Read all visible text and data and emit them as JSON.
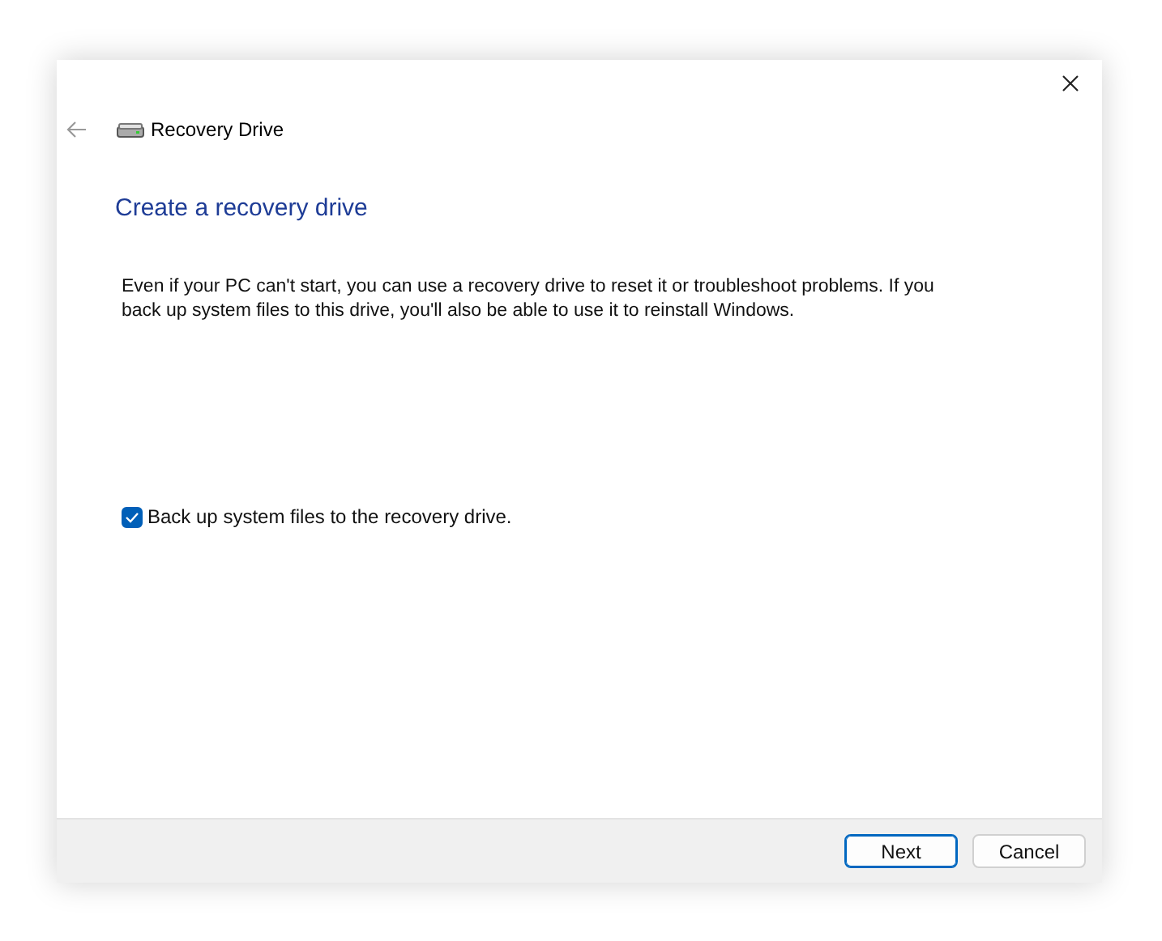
{
  "window": {
    "title": "Recovery Drive"
  },
  "heading": "Create a recovery drive",
  "description": "Even if your PC can't start, you can use a recovery drive to reset it or troubleshoot problems. If you back up system files to this drive, you'll also be able to use it to reinstall Windows.",
  "backup_option": {
    "label": "Back up system files to the recovery drive.",
    "checked": true
  },
  "buttons": [
    {
      "label": "Next",
      "default": true
    },
    {
      "label": "Cancel",
      "default": false
    }
  ]
}
